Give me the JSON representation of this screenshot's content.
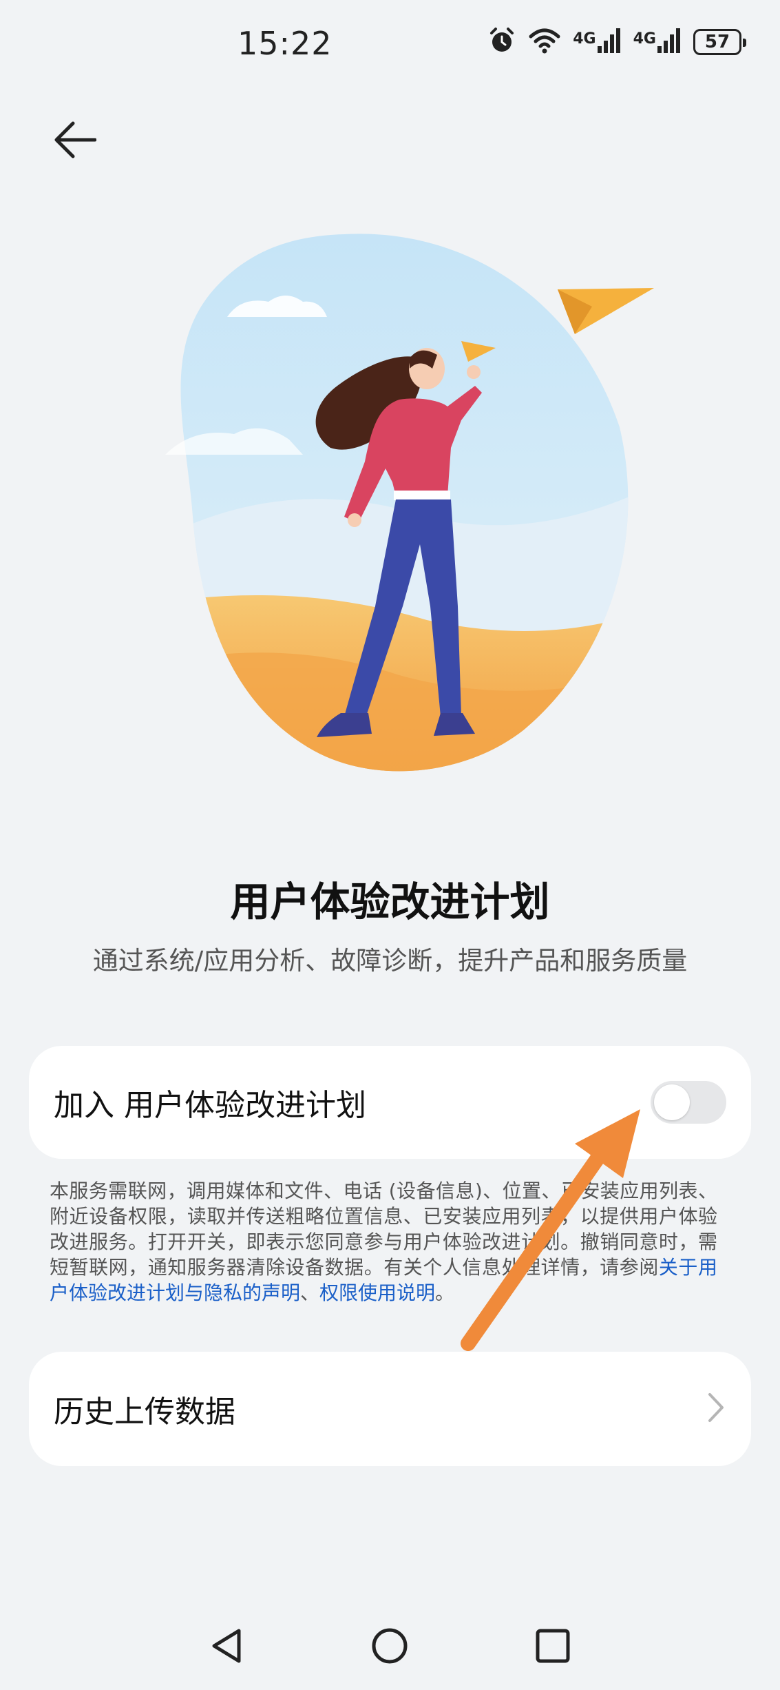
{
  "status_bar": {
    "time": "15:22",
    "network_1": "4G",
    "network_2": "4G",
    "battery": "57"
  },
  "page": {
    "title": "用户体验改进计划",
    "subtitle": "通过系统/应用分析、故障诊断，提升产品和服务质量"
  },
  "join_card": {
    "label": "加入 用户体验改进计划",
    "toggle_on": false
  },
  "disclaimer": {
    "text": "本服务需联网，调用媒体和文件、电话 (设备信息)、位置、已安装应用列表、附近设备权限，读取并传送粗略位置信息、已安装应用列表，以提供用户体验改进服务。打开开关，即表示您同意参与用户体验改进计划。撤销同意时，需短暂联网，通知服务器清除设备数据。有关个人信息处理详情，请参阅",
    "link_privacy": "关于用户体验改进计划与隐私的声明",
    "separator": "、",
    "link_permissions": "权限使用说明",
    "end": "。"
  },
  "history_card": {
    "label": "历史上传数据"
  },
  "colors": {
    "background": "#f1f3f5",
    "card": "#ffffff",
    "link": "#1a5fc8",
    "annotation_arrow": "#f08a3a",
    "toggle_off": "#e6e7e9"
  },
  "icons": {
    "back": "arrow-left-icon",
    "alarm": "alarm-icon",
    "wifi": "wifi-icon",
    "signal": "signal-icon",
    "battery": "battery-icon",
    "chevron": "chevron-right-icon",
    "nav_back": "triangle-back-icon",
    "nav_home": "circle-home-icon",
    "nav_recents": "square-recents-icon"
  }
}
